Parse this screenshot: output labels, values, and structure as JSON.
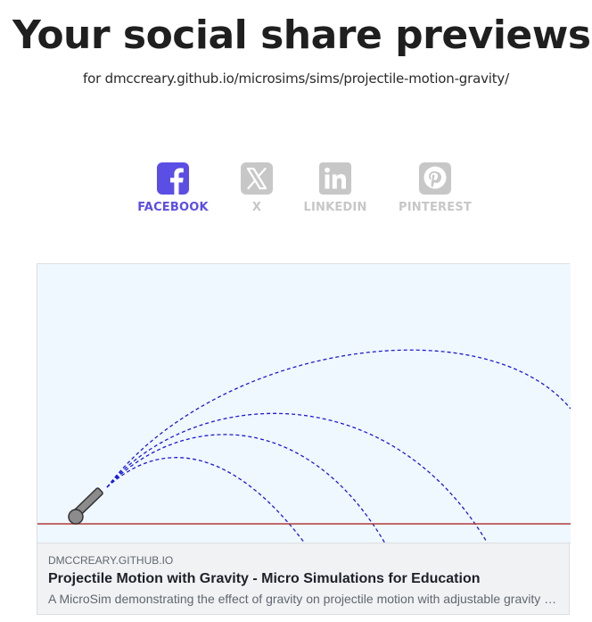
{
  "header": {
    "title": "Your social share previews",
    "subtitle": "for dmccreary.github.io/microsims/sims/projectile-motion-gravity/"
  },
  "tabs": [
    {
      "label": "FACEBOOK",
      "icon": "facebook-icon",
      "active": true
    },
    {
      "label": "X",
      "icon": "x-icon",
      "active": false
    },
    {
      "label": "LINKEDIN",
      "icon": "linkedin-icon",
      "active": false
    },
    {
      "label": "PINTEREST",
      "icon": "pinterest-icon",
      "active": false
    }
  ],
  "colors": {
    "active_tab": "#5b4ee5",
    "inactive_tab": "#c7c7c7",
    "preview_background": "#f0f8ff",
    "ground_line": "#b03a3a",
    "trajectory": "#1a1adb",
    "cannon": "#8c8c8c"
  },
  "preview": {
    "image_description_icon": "cannon-icon",
    "domain": "DMCCREARY.GITHUB.IO",
    "title": "Projectile Motion with Gravity - Micro Simulations for Education",
    "description": "A MicroSim demonstrating the effect of gravity on projectile motion with adjustable gravity and launch angle"
  }
}
